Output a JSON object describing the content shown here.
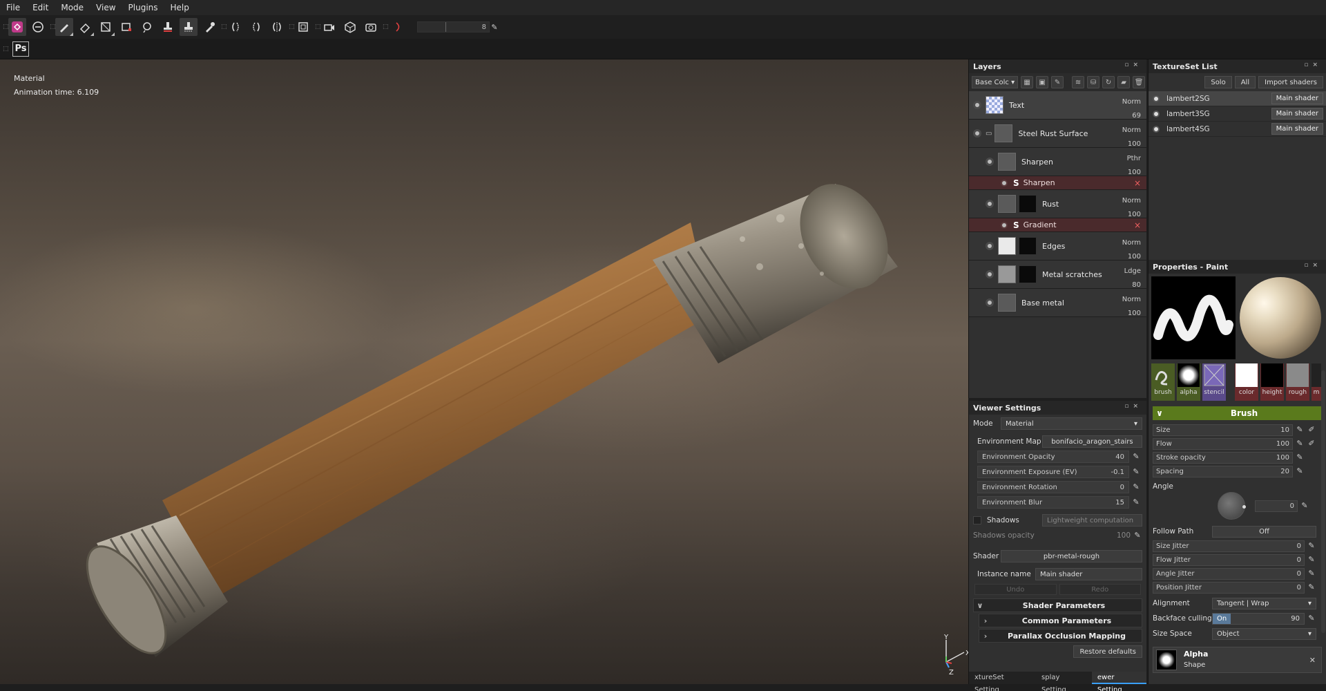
{
  "menu": [
    "File",
    "Edit",
    "Mode",
    "View",
    "Plugins",
    "Help"
  ],
  "toolbar": {
    "brush_size_value": "8",
    "photoshop_label": "Ps"
  },
  "viewport": {
    "mode_label": "Material",
    "animation_time": "Animation time: 6.109",
    "axis_y": "Y",
    "axis_x": "X",
    "axis_z": "Z"
  },
  "layers": {
    "title": "Layers",
    "channel_select": "Base Colc",
    "items": [
      {
        "name": "Text",
        "blend": "Norm",
        "opacity": "69"
      },
      {
        "name": "Steel Rust Surface",
        "blend": "Norm",
        "opacity": "100"
      },
      {
        "name": "Sharpen",
        "blend": "Pthr",
        "opacity": "100"
      },
      {
        "name": "Rust",
        "blend": "Norm",
        "opacity": "100"
      },
      {
        "name": "Edges",
        "blend": "Norm",
        "opacity": "100"
      },
      {
        "name": "Metal scratches",
        "blend": "Ldge",
        "opacity": "80"
      },
      {
        "name": "Base metal",
        "blend": "Norm",
        "opacity": "100"
      }
    ],
    "effects": [
      {
        "name": "Sharpen"
      },
      {
        "name": "Gradient"
      }
    ]
  },
  "viewer": {
    "title": "Viewer Settings",
    "mode_label": "Mode",
    "mode_value": "Material",
    "env_map_label": "Environment Map",
    "env_map_value": "bonifacio_aragon_stairs",
    "sliders": [
      {
        "label": "Environment Opacity",
        "value": "40"
      },
      {
        "label": "Environment Exposure (EV)",
        "value": "-0.1"
      },
      {
        "label": "Environment Rotation",
        "value": "0"
      },
      {
        "label": "Environment Blur",
        "value": "15"
      }
    ],
    "shadows_label": "Shadows",
    "shadows_value": "Lightweight computation",
    "shadows_opacity_label": "Shadows opacity",
    "shadows_opacity_value": "100",
    "shader_label": "Shader",
    "shader_value": "pbr-metal-rough",
    "instance_label": "Instance name",
    "instance_value": "Main shader",
    "undo": "Undo",
    "redo": "Redo",
    "sections": [
      "Shader Parameters",
      "Common Parameters",
      "Parallax Occlusion Mapping"
    ],
    "restore": "Restore defaults",
    "tabs": [
      "xtureSet Setting",
      "splay Setting",
      "ewer Setting"
    ]
  },
  "texset": {
    "title": "TextureSet List",
    "solo": "Solo",
    "all": "All",
    "import": "Import shaders",
    "items": [
      {
        "name": "lambert2SG",
        "shader": "Main shader"
      },
      {
        "name": "lambert3SG",
        "shader": "Main shader"
      },
      {
        "name": "lambert4SG",
        "shader": "Main shader"
      }
    ]
  },
  "props": {
    "title": "Properties - Paint",
    "slots": [
      "brush",
      "alpha",
      "stencil",
      "color",
      "height",
      "rough",
      "m"
    ],
    "brush_title": "Brush",
    "sliders": [
      {
        "label": "Size",
        "value": "10"
      },
      {
        "label": "Flow",
        "value": "100"
      },
      {
        "label": "Stroke opacity",
        "value": "100"
      },
      {
        "label": "Spacing",
        "value": "20"
      }
    ],
    "angle_label": "Angle",
    "angle_value": "0",
    "follow_path_label": "Follow Path",
    "follow_path_value": "Off",
    "jitters": [
      {
        "label": "Size Jitter",
        "value": "0"
      },
      {
        "label": "Flow Jitter",
        "value": "0"
      },
      {
        "label": "Angle Jitter",
        "value": "0"
      },
      {
        "label": "Position Jitter",
        "value": "0"
      }
    ],
    "alignment_label": "Alignment",
    "alignment_value": "Tangent | Wrap",
    "backface_label": "Backface culling",
    "backface_on": "On",
    "backface_value": "90",
    "size_space_label": "Size Space",
    "size_space_value": "Object",
    "alpha_title": "Alpha",
    "alpha_sub": "Shape"
  },
  "colors": {
    "brush_header": "#5a7a1c",
    "effect_row": "#4a2a2c",
    "active_tab": "#3aa0ff"
  }
}
